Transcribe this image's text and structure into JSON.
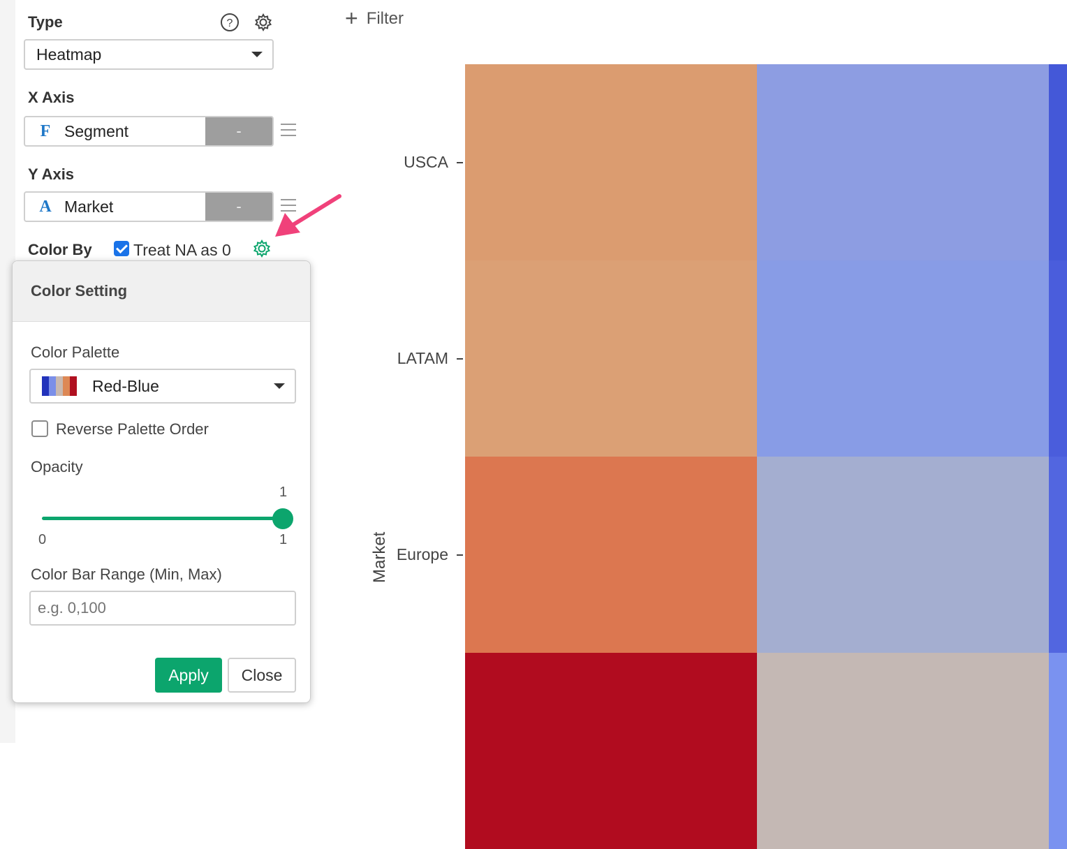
{
  "toolbar": {
    "filter_label": "Filter"
  },
  "sidebar": {
    "type": {
      "label": "Type",
      "selected": "Heatmap"
    },
    "x_axis": {
      "label": "X Axis",
      "field_type": "F",
      "field": "Segment",
      "minus": "-"
    },
    "y_axis": {
      "label": "Y Axis",
      "field_type": "A",
      "field": "Market",
      "minus": "-"
    },
    "color_by": {
      "label": "Color By",
      "treat_na_label": "Treat NA as 0",
      "treat_na_checked": true
    }
  },
  "color_setting": {
    "title": "Color Setting",
    "palette_label": "Color Palette",
    "palette_selected": "Red-Blue",
    "palette_swatches": [
      "#2233bb",
      "#7b8fe8",
      "#c9b9b0",
      "#dd8855",
      "#b01020"
    ],
    "reverse_label": "Reverse Palette Order",
    "reverse_checked": false,
    "opacity_label": "Opacity",
    "opacity_value": "1",
    "opacity_min": "0",
    "opacity_max": "1",
    "range_label": "Color Bar Range (Min, Max)",
    "range_placeholder": "e.g. 0,100",
    "apply_label": "Apply",
    "close_label": "Close"
  },
  "chart_data": {
    "type": "heatmap",
    "ylabel": "Market",
    "y_categories": [
      "USCA",
      "LATAM",
      "Europe",
      ""
    ],
    "cell_colors": [
      [
        "#db9c70",
        "#8d9de2",
        "#4458d8"
      ],
      [
        "#dba075",
        "#889ce6",
        "#4a5ddc"
      ],
      [
        "#dc7750",
        "#a4aed0",
        "#5266e0"
      ],
      [
        "#b10c1f",
        "#c4b8b4",
        "#7a92f0"
      ]
    ]
  },
  "colors": {
    "accent_green": "#0ca56d",
    "arrow_pink": "#f0417a"
  }
}
